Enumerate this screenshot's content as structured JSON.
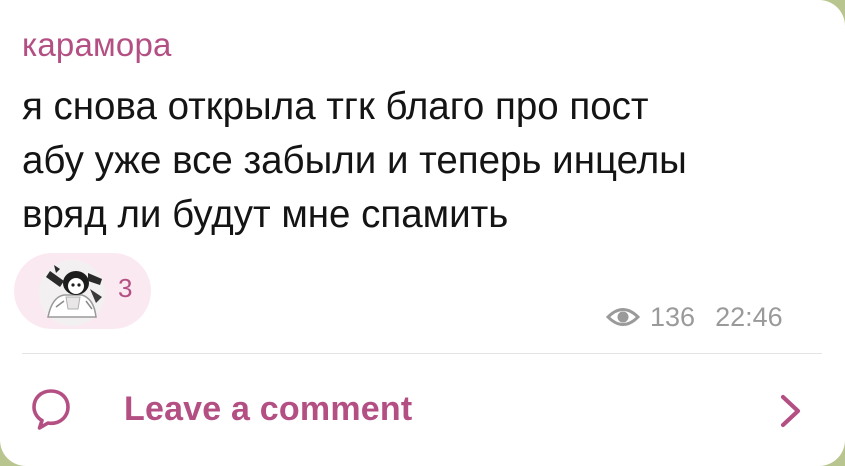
{
  "post": {
    "author": "карамора",
    "text_lines": [
      "я снова открыла тгк благо про пост",
      "абу уже все забыли и теперь инцелы",
      "вряд ли будут мне спамить"
    ],
    "reaction": {
      "icon": "custom-sticker-avatar-icon",
      "count": "3"
    },
    "views": "136",
    "time": "22:46"
  },
  "comments": {
    "label": "Leave a comment",
    "icon": "comment-bubble-icon",
    "chevron": "chevron-right-icon"
  },
  "colors": {
    "accent": "#b44f83",
    "reaction_bg": "#fbe9f2",
    "meta": "#9a9a9a",
    "background": "#b9c58f"
  }
}
